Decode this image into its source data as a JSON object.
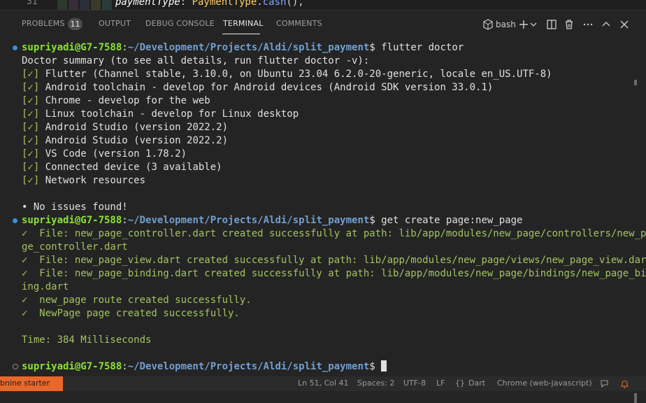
{
  "editor": {
    "line_number": "31",
    "code_prop": "paymentType",
    "code_colon": ": ",
    "code_type": "PaymentType",
    "code_dot": ".",
    "code_fn": "cash",
    "code_tail": "(),"
  },
  "panel": {
    "tabs": {
      "problems": "PROBLEMS",
      "problems_count": "11",
      "output": "OUTPUT",
      "debug_console": "DEBUG CONSOLE",
      "terminal": "TERMINAL",
      "comments": "COMMENTS"
    },
    "shell_label": "bash"
  },
  "terminal": {
    "prompt_user": "supriyadi@G7-7588",
    "prompt_sep": ":",
    "prompt_path": "~/Development/Projects/Aldi/split_payment",
    "prompt_symbol": "$ ",
    "cmd1": "flutter doctor",
    "summary": "Doctor summary (to see all details, run flutter doctor -v):",
    "checks": [
      {
        "mark": "[✓]",
        "text": " Flutter (Channel stable, 3.10.0, on Ubuntu 23.04 6.2.0-20-generic, locale en_US.UTF-8)"
      },
      {
        "mark": "[✓]",
        "text": " Android toolchain - develop for Android devices (Android SDK version 33.0.1)"
      },
      {
        "mark": "[✓]",
        "text": " Chrome - develop for the web"
      },
      {
        "mark": "[✓]",
        "text": " Linux toolchain - develop for Linux desktop"
      },
      {
        "mark": "[✓]",
        "text": " Android Studio (version 2022.2)"
      },
      {
        "mark": "[✓]",
        "text": " Android Studio (version 2022.2)"
      },
      {
        "mark": "[✓]",
        "text": " VS Code (version 1.78.2)"
      },
      {
        "mark": "[✓]",
        "text": " Connected device (3 available)"
      },
      {
        "mark": "[✓]",
        "text": " Network resources"
      }
    ],
    "no_issues": "• No issues found!",
    "cmd2": "get create page:new_page",
    "get_output": [
      "✓  File: new_page_controller.dart created successfully at path: lib/app/modules/new_page/controllers/new_pa",
      "ge_controller.dart",
      "✓  File: new_page_view.dart created successfully at path: lib/app/modules/new_page/views/new_page_view.dart",
      "✓  File: new_page_binding.dart created successfully at path: lib/app/modules/new_page/bindings/new_page_bind",
      "ing.dart",
      "✓  new_page route created successfully.",
      "✓  NewPage page created successfully."
    ],
    "time": "Time: 384 Milliseconds"
  },
  "statusbar": {
    "left": "bnine starter",
    "position": "Ln 51, Col 41",
    "spaces": "Spaces: 2",
    "encoding": "UTF-8",
    "eol": "LF",
    "lang_icon": "{}",
    "language": "Dart",
    "device": "Chrome (web-javascript)"
  },
  "colors": {
    "accent": "#e8672a",
    "prompt_user": "#8ae234",
    "prompt_path": "#729fcf",
    "success": "#a5c261"
  }
}
